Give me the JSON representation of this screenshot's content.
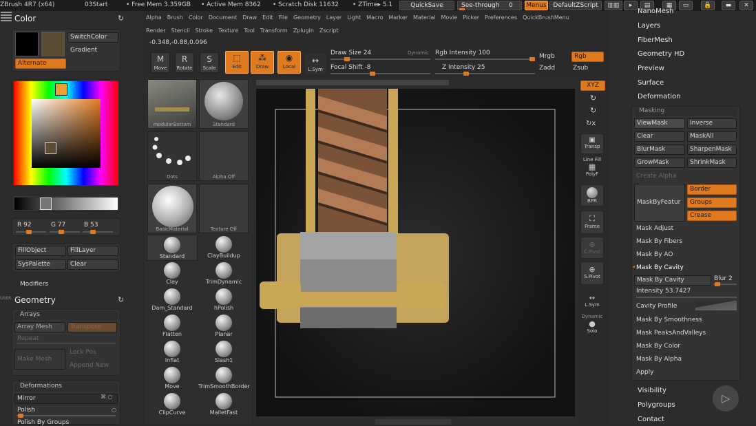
{
  "titlebar": {
    "app": "ZBrush 4R7 (x64)",
    "project": "03Start",
    "free_mem": "• Free Mem 3.359GB",
    "active_mem": "• Active Mem 8362",
    "scratch": "• Scratch Disk 11632",
    "ztime": "• ZTime▸ 5.1",
    "quicksave": "QuickSave",
    "seethrough": "See-through",
    "seethrough_value": "0",
    "menus": "Menus",
    "script": "DefaultZScript"
  },
  "menu_row1": [
    "Alpha",
    "Brush",
    "Color",
    "Document",
    "Draw",
    "Edit",
    "File",
    "Geometry",
    "Layer",
    "Light",
    "Macro",
    "Marker",
    "Material",
    "Movie",
    "Picker",
    "Preferences",
    "QuickBrushMenu"
  ],
  "menu_row2": [
    "Render",
    "Stencil",
    "Stroke",
    "Texture",
    "Tool",
    "Transform",
    "Zplugin",
    "Zscript"
  ],
  "coords": "-0.348,-0.88,0.096",
  "tools": {
    "move": "Move",
    "rotate": "Rotate",
    "scale": "Scale",
    "edit": "Edit",
    "draw": "Draw",
    "local": "Local",
    "lsym": "L.Sym"
  },
  "draw_controls": {
    "draw_size": "Draw Size 24",
    "dynamic": "Dynamic",
    "draw_size_value": 24,
    "focal_shift": "Focal Shift -8",
    "focal_shift_value": -8,
    "rgb_intensity": "Rgb Intensity 100",
    "rgb_intensity_value": 100,
    "z_intensity": "Z Intensity 25",
    "z_intensity_value": 25,
    "mrgb": "Mrgb",
    "rgb": "Rgb",
    "zadd": "Zadd",
    "zsub": "Zsub"
  },
  "color_panel": {
    "title": "Color",
    "switchcolor": "SwitchColor",
    "gradient": "Gradient",
    "alternate": "Alternate",
    "r": "R 92",
    "g": "G 77",
    "b": "B 53",
    "fillobject": "FillObject",
    "filllayer": "FillLayer",
    "syspalette": "SysPalette",
    "clear": "Clear",
    "modifiers": "Modifiers",
    "primary_color": "#000000",
    "secondary_color": "#5c4d35"
  },
  "geometry_panel": {
    "user": "USER",
    "title": "Geometry",
    "arrays": "Arrays",
    "array_mesh": "Array Mesh",
    "transpose": "Transpose",
    "repeat": "Repeat",
    "make_mesh": "Make Mesh",
    "lock_pos": "Lock Pos",
    "append_new": "Append New",
    "deformations": "Deformations",
    "mirror": "Mirror",
    "polish": "Polish",
    "polish_by_groups": "Polish By Groups"
  },
  "brush_palette": {
    "thumbs": [
      {
        "caption": "modularBottom"
      },
      {
        "caption": "Standard"
      },
      {
        "caption": "Dots"
      },
      {
        "caption": "Alpha Off"
      },
      {
        "caption": "BasicMaterial"
      },
      {
        "caption": "Texture Off"
      }
    ],
    "brushes": [
      "Standard",
      "ClayBuildup",
      "Clay",
      "TrimDynamic",
      "Dam_Standard",
      "hPolish",
      "Flatten",
      "Planar",
      "Inflat",
      "Slash1",
      "Move",
      "TrimSmoothBorder",
      "ClipCurve",
      "MalletFast"
    ]
  },
  "right_strip": {
    "xyz": "XYZ",
    "transp": "Transp",
    "linefill": "Line Fill",
    "polyf": "PolyF",
    "bpr": "BPR",
    "frame": "Frame",
    "cpivot": "C.Pivot",
    "spivot": "S.Pivot",
    "lsym": "L.Sym",
    "dynamic": "Dynamic",
    "solo": "Solo"
  },
  "tool_palette": {
    "nanomesh": "NanoMesh",
    "layers": "Layers",
    "fibermesh": "FiberMesh",
    "geometry_hd": "Geometry HD",
    "preview": "Preview",
    "surface": "Surface",
    "deformation": "Deformation",
    "masking": {
      "title": "Masking",
      "viewmask": "ViewMask",
      "inverse": "Inverse",
      "clear": "Clear",
      "maskall": "MaskAll",
      "blurmask": "BlurMask",
      "sharpenmask": "SharpenMask",
      "growmask": "GrowMask",
      "shrinkmask": "ShrinkMask",
      "create_alpha": "Create Alpha",
      "maskbyfeature": "MaskByFeatur",
      "border": "Border",
      "groups": "Groups",
      "crease": "Crease",
      "mask_adjust": "Mask Adjust",
      "mask_by_fibers": "Mask By Fibers",
      "mask_by_ao": "Mask By AO",
      "mask_by_cavity_header": "Mask By Cavity",
      "mask_by_cavity_btn": "Mask By Cavity",
      "blur": "Blur 2",
      "intensity": "Intensity 53.7427",
      "intensity_value": 53.7427,
      "cavity_profile": "Cavity Profile",
      "mask_by_smoothness": "Mask By Smoothness",
      "mask_peaks": "Mask PeaksAndValleys",
      "mask_by_color": "Mask By Color",
      "mask_by_alpha": "Mask By Alpha",
      "apply": "Apply"
    },
    "visibility": "Visibility",
    "polygroups": "Polygroups",
    "contact": "Contact"
  },
  "colors": {
    "accent": "#e07a1f",
    "panel": "#333333",
    "bg": "#2a2a2a"
  }
}
